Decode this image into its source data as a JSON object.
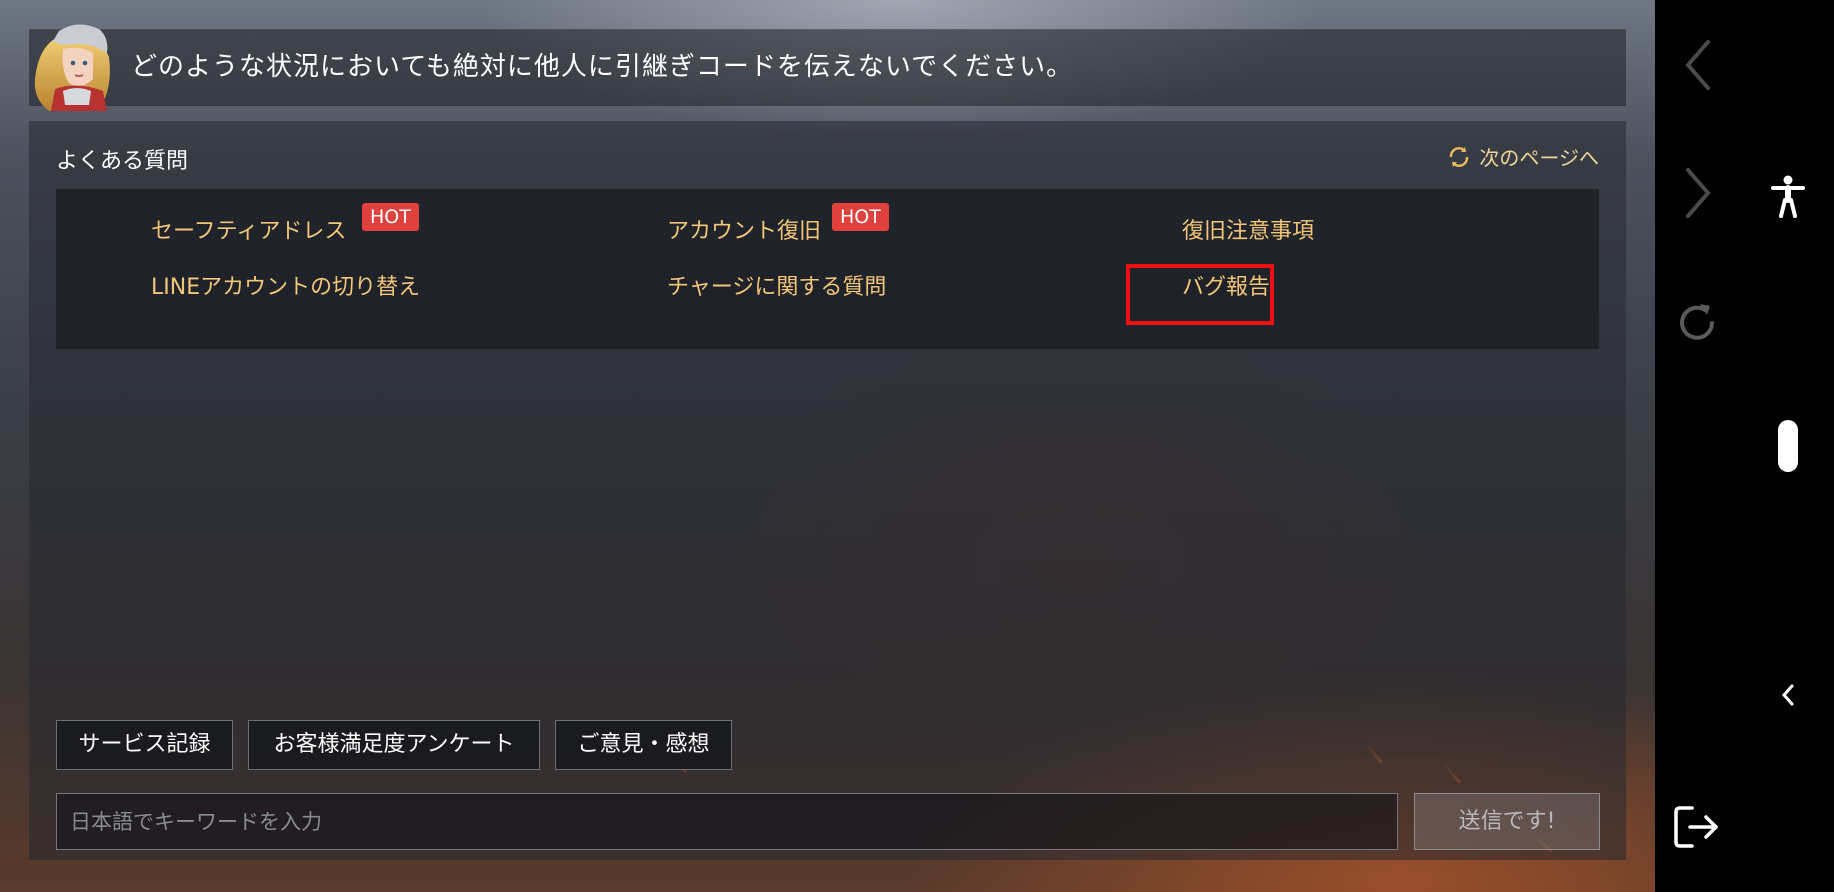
{
  "banner": {
    "message": "どのような状況においても絶対に他人に引継ぎコードを伝えないでください。"
  },
  "faq": {
    "title": "よくある質問",
    "next_page_label": "次のページへ",
    "items": [
      {
        "label": "セーフティアドレス",
        "hot": "HOT"
      },
      {
        "label": "アカウント復旧",
        "hot": "HOT"
      },
      {
        "label": "復旧注意事項"
      },
      {
        "label": "LINEアカウントの切り替え"
      },
      {
        "label": "チャージに関する質問"
      },
      {
        "label": "バグ報告",
        "highlighted": true
      }
    ]
  },
  "bottom_tabs": {
    "service_record": "サービス記録",
    "survey": "お客様満足度アンケート",
    "feedback": "ご意見・感想"
  },
  "search": {
    "placeholder": "日本語でキーワードを入力",
    "send_label": "送信です!"
  },
  "colors": {
    "faq_item": "#f2c77a",
    "hot_badge": "#e0413c",
    "highlight": "#ee1111"
  },
  "navbar_icons": [
    "back-arrow-icon",
    "forward-arrow-icon",
    "reload-icon",
    "accessibility-icon",
    "collapse-chevron-icon",
    "exit-icon"
  ]
}
